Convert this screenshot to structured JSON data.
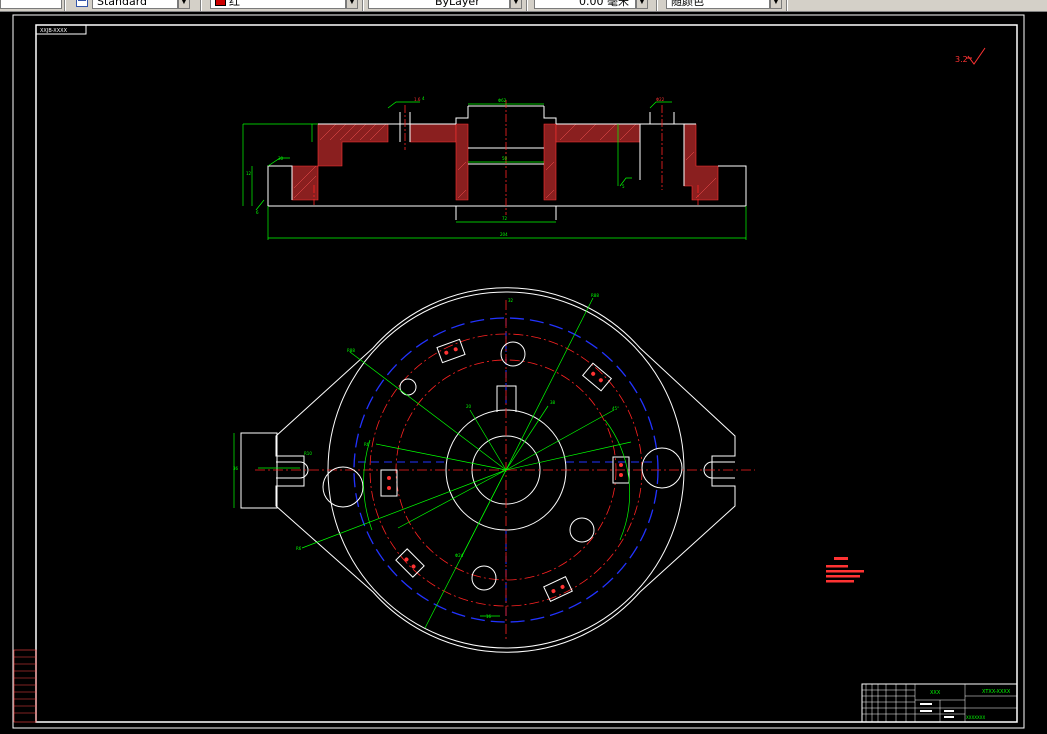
{
  "toolbar": {
    "textstyle_value": "Standard",
    "color_value": "红",
    "linetype_value": "ByLayer",
    "lineweight_value": "0.00 毫米",
    "plotstyle_value": "随颜色",
    "color_swatch": "#cc0000"
  },
  "drawing": {
    "stamp": "XXJB-XXXX",
    "roughness": "3.2",
    "drawing_number": "XTXX-XXXX",
    "part_name": "XXXXXXX",
    "table_header": "XXX"
  },
  "colors": {
    "background": "#000000",
    "outline": "#ffffff",
    "dimension": "#00ff00",
    "centerline": "#ff0000",
    "hidden": "#0000ff",
    "hatch": "#cc3333"
  }
}
